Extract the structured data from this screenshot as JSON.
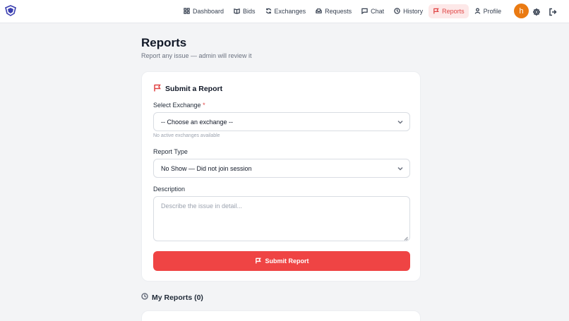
{
  "nav": {
    "items": [
      {
        "label": "Dashboard",
        "icon": "grid-icon"
      },
      {
        "label": "Bids",
        "icon": "book-icon"
      },
      {
        "label": "Exchanges",
        "icon": "refresh-icon"
      },
      {
        "label": "Requests",
        "icon": "inbox-icon"
      },
      {
        "label": "Chat",
        "icon": "chat-icon"
      },
      {
        "label": "History",
        "icon": "clock-icon"
      },
      {
        "label": "Reports",
        "icon": "flag-icon",
        "active": true
      },
      {
        "label": "Profile",
        "icon": "user-icon"
      }
    ],
    "avatar_initial": "h",
    "avatar_color": "#ea7a12",
    "accent_color": "#e04444"
  },
  "page": {
    "title": "Reports",
    "subtitle": "Report any issue — admin will review it"
  },
  "form": {
    "title": "Submit a Report",
    "exchange_label": "Select Exchange",
    "required_mark": "*",
    "exchange_value": "-- Choose an exchange --",
    "exchange_hint": "No active exchanges available",
    "type_label": "Report Type",
    "type_value": "No Show — Did not join session",
    "description_label": "Description",
    "description_placeholder": "Describe the issue in detail...",
    "submit_label": "Submit Report",
    "submit_color": "#ef4444"
  },
  "my_reports": {
    "title": "My Reports (0)"
  }
}
